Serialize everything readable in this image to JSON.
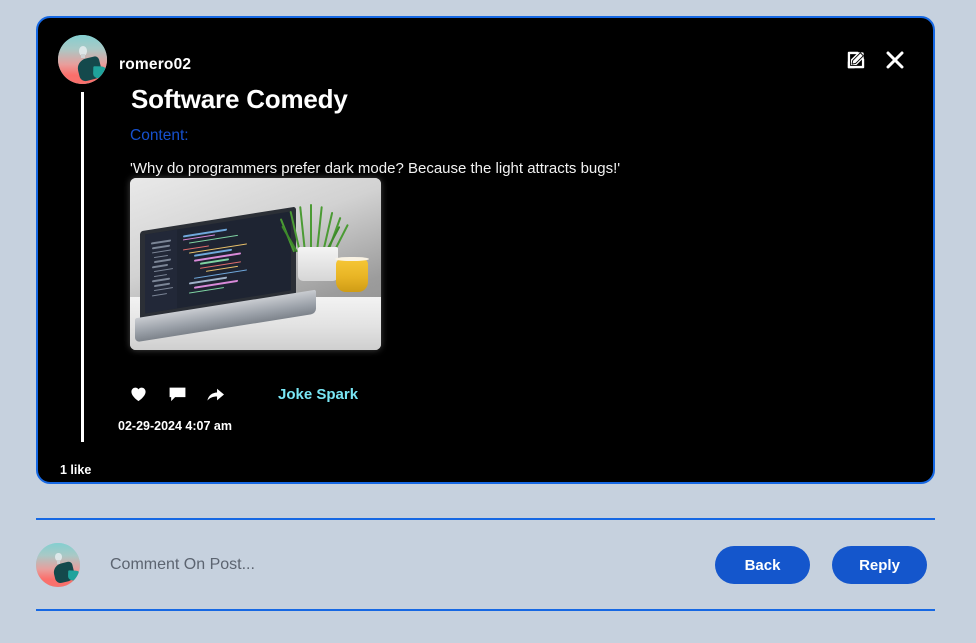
{
  "post": {
    "username": "romero02",
    "title": "Software Comedy",
    "content_label": "Content:",
    "content_text": "'Why do programmers prefer dark mode? Because the light attracts bugs!'",
    "tag": "Joke Spark",
    "timestamp": "02-29-2024 4:07 am",
    "likes": "1 like",
    "media_alt": "laptop with code editor, plant and yellow mug on white desk",
    "icons": {
      "edit": "edit-square-icon",
      "close": "close-icon",
      "like": "heart-icon",
      "comment": "comment-bubble-icon",
      "share": "share-arrow-icon",
      "avatar": "user-avatar"
    }
  },
  "comment_bar": {
    "placeholder": "Comment On Post...",
    "avatar": "user-avatar",
    "back_label": "Back",
    "reply_label": "Reply"
  },
  "colors": {
    "page_background": "#c6d1de",
    "card_background": "#000000",
    "card_border": "#1668e3",
    "accent_blue": "#1456cc",
    "content_label": "#1651cf",
    "tag_cyan": "#79e6f5",
    "divider": "#1668e3"
  }
}
